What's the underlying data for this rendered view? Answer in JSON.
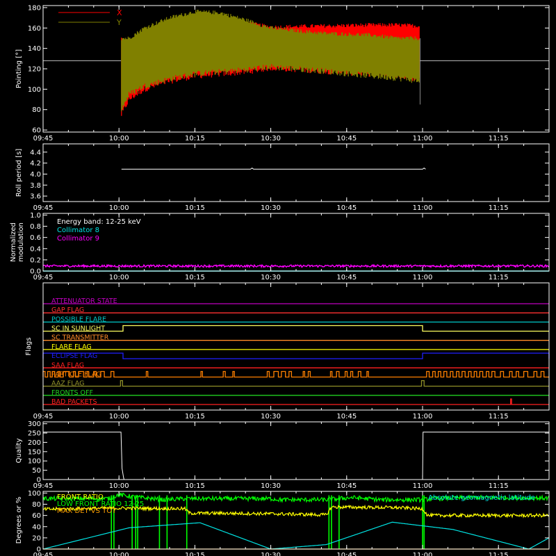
{
  "colors": {
    "background": "#000000",
    "axes": "#ffffff",
    "x_pointing": "#ff0000",
    "y_pointing": "#808000",
    "collimator8": "#00e5e5",
    "collimator9": "#ff00ff"
  },
  "time_axis": {
    "range_minutes": [
      585,
      685
    ],
    "ticks": [
      {
        "value": 585,
        "label": "09:45"
      },
      {
        "value": 600,
        "label": "10:00"
      },
      {
        "value": 615,
        "label": "10:15"
      },
      {
        "value": 630,
        "label": "10:30"
      },
      {
        "value": 645,
        "label": "10:45"
      },
      {
        "value": 660,
        "label": "11:00"
      },
      {
        "value": 675,
        "label": "11:15"
      }
    ]
  },
  "chart_data": [
    {
      "id": "pointing",
      "type": "area",
      "ylabel": "Pointing [°]",
      "ylim": [
        58,
        182
      ],
      "yticks": [
        60,
        80,
        100,
        120,
        140,
        160,
        180
      ],
      "reference_line": 128,
      "legend": [
        {
          "name": "X",
          "color": "#ff0000"
        },
        {
          "name": "Y",
          "color": "#808000"
        }
      ],
      "series": [
        {
          "name": "X",
          "color": "#ff0000",
          "x": [
            600.5,
            602,
            605,
            610,
            615,
            620,
            625,
            630,
            640,
            650,
            655,
            659.5
          ],
          "upper": [
            150,
            140,
            150,
            162,
            170,
            170,
            165,
            161,
            162,
            163,
            163,
            162
          ],
          "lower": [
            75,
            90,
            100,
            108,
            113,
            115,
            117,
            121,
            118,
            115,
            113,
            110
          ]
        },
        {
          "name": "Y",
          "color": "#808000",
          "x": [
            600.5,
            602,
            605,
            610,
            615,
            620,
            625,
            630,
            640,
            650,
            655,
            659.5
          ],
          "upper": [
            150,
            150,
            160,
            170,
            176,
            175,
            168,
            160,
            155,
            153,
            150,
            150
          ],
          "lower": [
            80,
            95,
            103,
            110,
            115,
            117,
            119,
            122,
            118,
            113,
            111,
            108
          ]
        }
      ]
    },
    {
      "id": "roll",
      "type": "line",
      "ylabel": "Roll period [s]",
      "ylim": [
        3.5,
        4.55
      ],
      "yticks": [
        3.6,
        3.8,
        4.0,
        4.2,
        4.4
      ],
      "series": [
        {
          "name": "roll",
          "color": "#ffffff",
          "x": [
            600.5,
            626,
            626.3,
            626.6,
            660,
            660.3,
            660.6
          ],
          "y": [
            4.09,
            4.09,
            4.11,
            4.09,
            4.09,
            4.11,
            4.09
          ]
        }
      ]
    },
    {
      "id": "modulation",
      "type": "line",
      "ylabel": [
        "Normalized",
        "modulation"
      ],
      "ylim": [
        0,
        1.03
      ],
      "yticks": [
        0.0,
        0.2,
        0.4,
        0.6,
        0.8,
        1.0
      ],
      "annotations": [
        "Energy band: 12-25 keV"
      ],
      "legend": [
        {
          "name": "Collimator 8",
          "color": "#00e5e5"
        },
        {
          "name": "Collimator 9",
          "color": "#ff00ff"
        }
      ],
      "series": [
        {
          "name": "Collimator 8",
          "color": "#00e5e5",
          "x": [
            585,
            685
          ],
          "y": [
            0.0,
            0.0
          ]
        },
        {
          "name": "Collimator 9",
          "color": "#ff00ff",
          "x": [
            585,
            685
          ],
          "y": [
            0.09,
            0.09
          ],
          "noise": 0.02
        }
      ]
    },
    {
      "id": "flags",
      "type": "line",
      "ylabel": "Flags",
      "rows": [
        {
          "name": "ATTENUATOR STATE",
          "color": "#c000c0",
          "intervals": []
        },
        {
          "name": "GAP FLAG",
          "color": "#ff3030",
          "intervals": []
        },
        {
          "name": "POSSIBLE FLARE",
          "color": "#00c8c8",
          "intervals": []
        },
        {
          "name": "SC IN SUNLIGHT",
          "color": "#ffff60",
          "intervals": [
            [
              600.8,
              660.0
            ]
          ]
        },
        {
          "name": "SC TRANSMITTER",
          "color": "#ff8c28",
          "intervals": []
        },
        {
          "name": "FLARE FLAG",
          "color": "#ffff00",
          "intervals": []
        },
        {
          "name": "ECLIPSE FLAG",
          "color": "#2020ff",
          "intervals": [
            [
              585,
              600.8
            ],
            [
              660.0,
              685
            ]
          ]
        },
        {
          "name": "SAA FLAG",
          "color": "#ff2020",
          "intervals": []
        },
        {
          "name": "PARTICLE FLAG",
          "color": "#ff8000",
          "intervals": [
            [
              585,
              585.4
            ],
            [
              585.9,
              586.4
            ],
            [
              586.8,
              587.3
            ],
            [
              588.0,
              588.3
            ],
            [
              589.0,
              590.2
            ],
            [
              591.0,
              591.4
            ],
            [
              592.0,
              593.0
            ],
            [
              593.7,
              594.0
            ],
            [
              595.0,
              595.5
            ],
            [
              596.4,
              597.1
            ],
            [
              598.4,
              599.0
            ],
            [
              605.4,
              605.7
            ],
            [
              616.2,
              616.5
            ],
            [
              620.6,
              621.0
            ],
            [
              622.5,
              622.8
            ],
            [
              629.3,
              629.7
            ],
            [
              630.6,
              631.5
            ],
            [
              632.1,
              632.9
            ],
            [
              633.6,
              634.1
            ],
            [
              636.4,
              636.7
            ],
            [
              637.4,
              637.8
            ],
            [
              641.8,
              642.1
            ],
            [
              643.0,
              643.5
            ],
            [
              644.7,
              645.1
            ],
            [
              645.8,
              646.2
            ],
            [
              647.3,
              647.8
            ],
            [
              649.0,
              649.3
            ],
            [
              660.8,
              661.3
            ],
            [
              662.0,
              662.5
            ],
            [
              663.1,
              663.6
            ],
            [
              664.2,
              664.8
            ],
            [
              665.5,
              666.0
            ],
            [
              666.7,
              667.2
            ],
            [
              667.8,
              668.4
            ],
            [
              669.1,
              669.6
            ],
            [
              670.2,
              670.7
            ],
            [
              671.3,
              671.9
            ],
            [
              672.6,
              673.1
            ],
            [
              673.7,
              674.3
            ],
            [
              675.4,
              676.0
            ],
            [
              677.2,
              677.7
            ],
            [
              678.5,
              679.0
            ],
            [
              680.0,
              680.8
            ],
            [
              682.0,
              682.6
            ],
            [
              683.4,
              684.0
            ]
          ]
        },
        {
          "name": "AAZ FLAG",
          "color": "#909028",
          "intervals": [
            [
              600.3,
              600.7
            ],
            [
              659.8,
              660.3
            ]
          ]
        },
        {
          "name": "FRONTS OFF",
          "color": "#20d020",
          "intervals": []
        },
        {
          "name": "BAD PACKETS",
          "color": "#ff2020",
          "intervals": [
            [
              677.4,
              677.6
            ]
          ]
        }
      ]
    },
    {
      "id": "quality",
      "type": "line",
      "ylabel": "Quality",
      "ylim": [
        0,
        310
      ],
      "yticks": [
        0,
        50,
        100,
        150,
        200,
        250,
        300
      ],
      "series": [
        {
          "name": "quality",
          "color": "#ffffff",
          "x": [
            585,
            600.4,
            600.6,
            600.9,
            601.0,
            660.0,
            660.1,
            685
          ],
          "y": [
            255,
            255,
            60,
            10,
            0,
            0,
            255,
            255
          ]
        }
      ]
    },
    {
      "id": "ratio",
      "type": "line",
      "ylabel": "Degrees or %",
      "ylim": [
        0,
        103
      ],
      "yticks": [
        0,
        20,
        40,
        60,
        80,
        100
      ],
      "legend": [
        {
          "name": "FRONT RATIO",
          "color": "#ffff00"
        },
        {
          "name": "LOW FRONT RATIO 12-25",
          "color": "#00ff00"
        },
        {
          "name": "MAX DET VS TOT",
          "color": "#ffa000"
        },
        {
          "name": "Absolute geomagnetic latitude",
          "color": "#00e5e5"
        }
      ],
      "series": [
        {
          "name": "Absolute geomagnetic latitude",
          "color": "#00e5e5",
          "x": [
            585,
            602,
            616,
            630,
            641,
            654,
            666,
            681,
            685
          ],
          "y": [
            0,
            38,
            47,
            0,
            8,
            48,
            35,
            0,
            20
          ]
        },
        {
          "name": "LOW FRONT RATIO 12-25",
          "color": "#00ff00",
          "x": [
            585,
            598,
            600,
            603,
            609,
            613,
            630,
            632,
            641,
            646,
            652,
            660,
            662,
            670,
            685
          ],
          "y": [
            90,
            90,
            97,
            93,
            88,
            90,
            90,
            88,
            88,
            92,
            88,
            88,
            90,
            92,
            91
          ],
          "noise": 4
        },
        {
          "name": "FRONT RATIO",
          "color": "#ffff00",
          "x": [
            585,
            597,
            598,
            602,
            613,
            614,
            620,
            630,
            641,
            642,
            655,
            660,
            661,
            685
          ],
          "y": [
            71,
            73,
            73,
            73,
            72,
            64,
            64,
            63,
            61,
            75,
            74,
            72,
            60,
            60
          ],
          "noise": 3
        },
        {
          "name": "MAX DET VS TOT",
          "color": "#ffa000",
          "x": [
            585,
            685
          ],
          "y": [
            0,
            0
          ]
        }
      ],
      "spikes": [
        598.5,
        599.0,
        602.6,
        603.3,
        603.7,
        608.0,
        609.5,
        613.4,
        641.5,
        642.0,
        643.5,
        660.0,
        660.3
      ]
    }
  ]
}
